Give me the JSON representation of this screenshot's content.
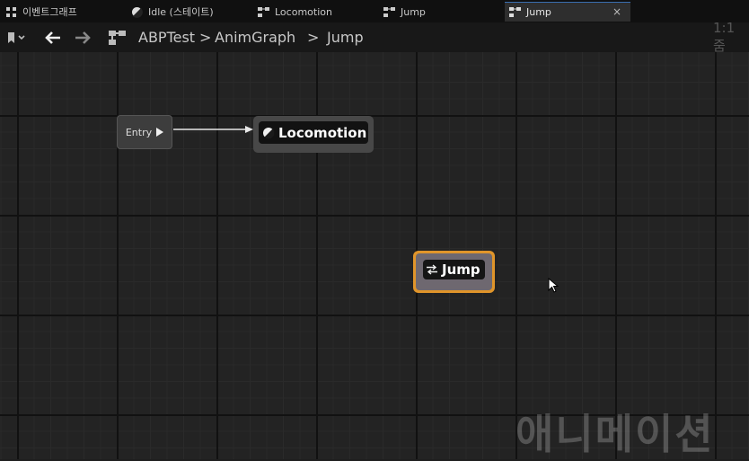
{
  "tabs": [
    {
      "label": "이벤트그래프",
      "icon": "event-graph-icon"
    },
    {
      "label": "Idle (스테이트)",
      "icon": "state-icon"
    },
    {
      "label": "Locomotion",
      "icon": "state-machine-icon"
    },
    {
      "label": "Jump",
      "icon": "state-machine-icon"
    },
    {
      "label": "Jump",
      "icon": "state-machine-icon",
      "active": true,
      "close": "×"
    }
  ],
  "toolbar": {
    "breadcrumb": [
      "ABPTest",
      "AnimGraph",
      "Jump"
    ],
    "separator_1": ">",
    "separator_2": ">",
    "zoom": "1:1 줌"
  },
  "graph": {
    "nodes": {
      "entry": "Entry",
      "locomotion": "Locomotion",
      "jump": "Jump"
    }
  },
  "watermark": "애니메이션",
  "colors": {
    "selected_outline": "#e0952a",
    "tab_active_accent": "#3a6fb0",
    "background": "#232323"
  }
}
